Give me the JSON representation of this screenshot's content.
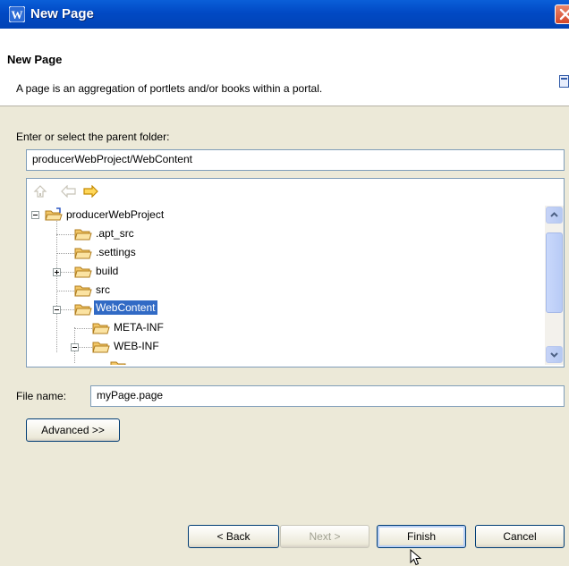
{
  "window": {
    "title": "New Page"
  },
  "banner": {
    "title": "New Page",
    "description": "A page is an aggregation of portlets and/or books within a portal."
  },
  "parent_folder": {
    "label": "Enter or select the parent folder:",
    "value": "producerWebProject/WebContent"
  },
  "tree": {
    "items": [
      {
        "label": "producerWebProject"
      },
      {
        "label": ".apt_src"
      },
      {
        "label": ".settings"
      },
      {
        "label": "build"
      },
      {
        "label": "src"
      },
      {
        "label": "WebContent"
      },
      {
        "label": "META-INF"
      },
      {
        "label": "WEB-INF"
      }
    ]
  },
  "file_name": {
    "label": "File name:",
    "value": "myPage.page"
  },
  "buttons": {
    "advanced": "Advanced >>",
    "back": "< Back",
    "next": "Next >",
    "finish": "Finish",
    "cancel": "Cancel"
  },
  "icons": {
    "app": "weblogic-w-icon",
    "close": "close-icon",
    "banner": "page-wizard-icon",
    "up": "go-up-icon",
    "back": "back-arrow-icon",
    "forward": "forward-arrow-icon",
    "folder": "folder-icon",
    "project": "project-folder-icon",
    "scroll_up": "scroll-up-icon",
    "scroll_down": "scroll-down-icon",
    "cursor": "mouse-pointer-icon"
  },
  "colors": {
    "titlebar": "#0149c4",
    "selection": "#316ac5",
    "dialog_bg": "#ece9d8"
  }
}
